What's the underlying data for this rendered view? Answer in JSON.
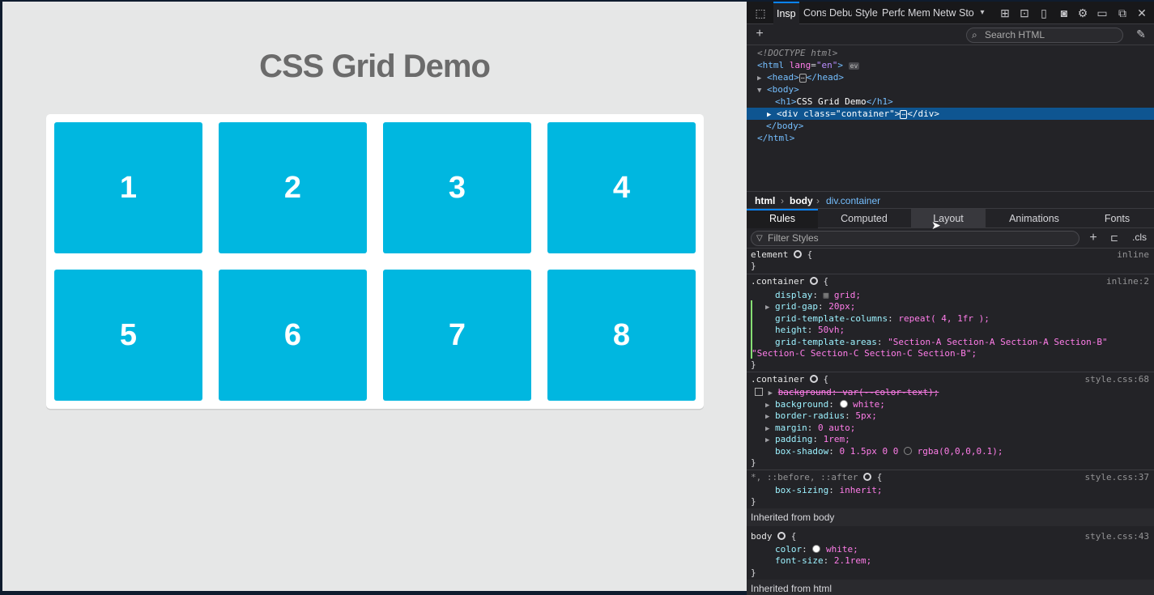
{
  "page": {
    "title": "CSS Grid Demo",
    "cells": [
      "1",
      "2",
      "3",
      "4",
      "5",
      "6",
      "7",
      "8"
    ]
  },
  "devtools": {
    "tabs": [
      "Insp",
      "Cons",
      "Debu",
      "Style",
      "Perfo",
      "Mem",
      "Netw",
      "Sto"
    ],
    "active_tab": "Insp",
    "search_placeholder": "Search HTML",
    "markup": {
      "doctype": "<!DOCTYPE html>",
      "html_open": "<html",
      "html_attr": "lang",
      "html_val": "\"en\"",
      "ev_badge": "ev",
      "head": "<head>",
      "head_close": "</head>",
      "body_open": "<body>",
      "h1_open": "<h1>",
      "h1_text": "CSS Grid Demo",
      "h1_close": "</h1>",
      "div_open": "<div class=\"container\">",
      "div_close": "</div>",
      "body_close": "</body>",
      "html_close": "</html>"
    },
    "breadcrumbs": [
      "html",
      "body",
      "div.container"
    ],
    "subtabs": [
      "Rules",
      "Computed",
      "Layout",
      "Animations",
      "Fonts"
    ],
    "active_subtab": "Rules",
    "filter_placeholder": "Filter Styles",
    "cls_label": ".cls",
    "rules": {
      "element": {
        "selector": "element",
        "source": "inline"
      },
      "container_inline": {
        "selector": ".container",
        "source": "inline:2",
        "decls": [
          {
            "prop": "display",
            "value": "grid"
          },
          {
            "prop": "grid-gap",
            "value": "20px"
          },
          {
            "prop": "grid-template-columns",
            "value": "repeat( 4, 1fr );"
          },
          {
            "prop": "height",
            "value": "50vh;"
          },
          {
            "prop": "grid-template-areas",
            "value": "\"Section-A Section-A Section-A Section-B\""
          },
          {
            "prop": "",
            "value": "\"Section-C Section-C Section-C Section-B\";"
          }
        ]
      },
      "container_css": {
        "selector": ".container",
        "source": "style.css:68",
        "decls": [
          {
            "prop": "background",
            "value": "var(--color-text);"
          },
          {
            "prop": "background",
            "value": "white;"
          },
          {
            "prop": "border-radius",
            "value": "5px;"
          },
          {
            "prop": "margin",
            "value": "0 auto;"
          },
          {
            "prop": "padding",
            "value": "1rem;"
          },
          {
            "prop": "box-shadow",
            "value": "0 1.5px 0 0",
            "value2": "rgba(0,0,0,0.1);"
          }
        ]
      },
      "universal": {
        "selector": "*, ::before, ::after",
        "source": "style.css:37",
        "decls": [
          {
            "prop": "box-sizing",
            "value": "inherit;"
          }
        ]
      },
      "inherited_body_label": "Inherited from body",
      "body": {
        "selector": "body",
        "source": "style.css:43",
        "decls": [
          {
            "prop": "color",
            "value": "white;"
          },
          {
            "prop": "font-size",
            "value": "2.1rem;"
          }
        ]
      },
      "inherited_html_label": "Inherited from html"
    }
  },
  "colors": {
    "cell": "#00b7e0",
    "devtools_bg": "#232327",
    "selection": "#0e5591"
  }
}
